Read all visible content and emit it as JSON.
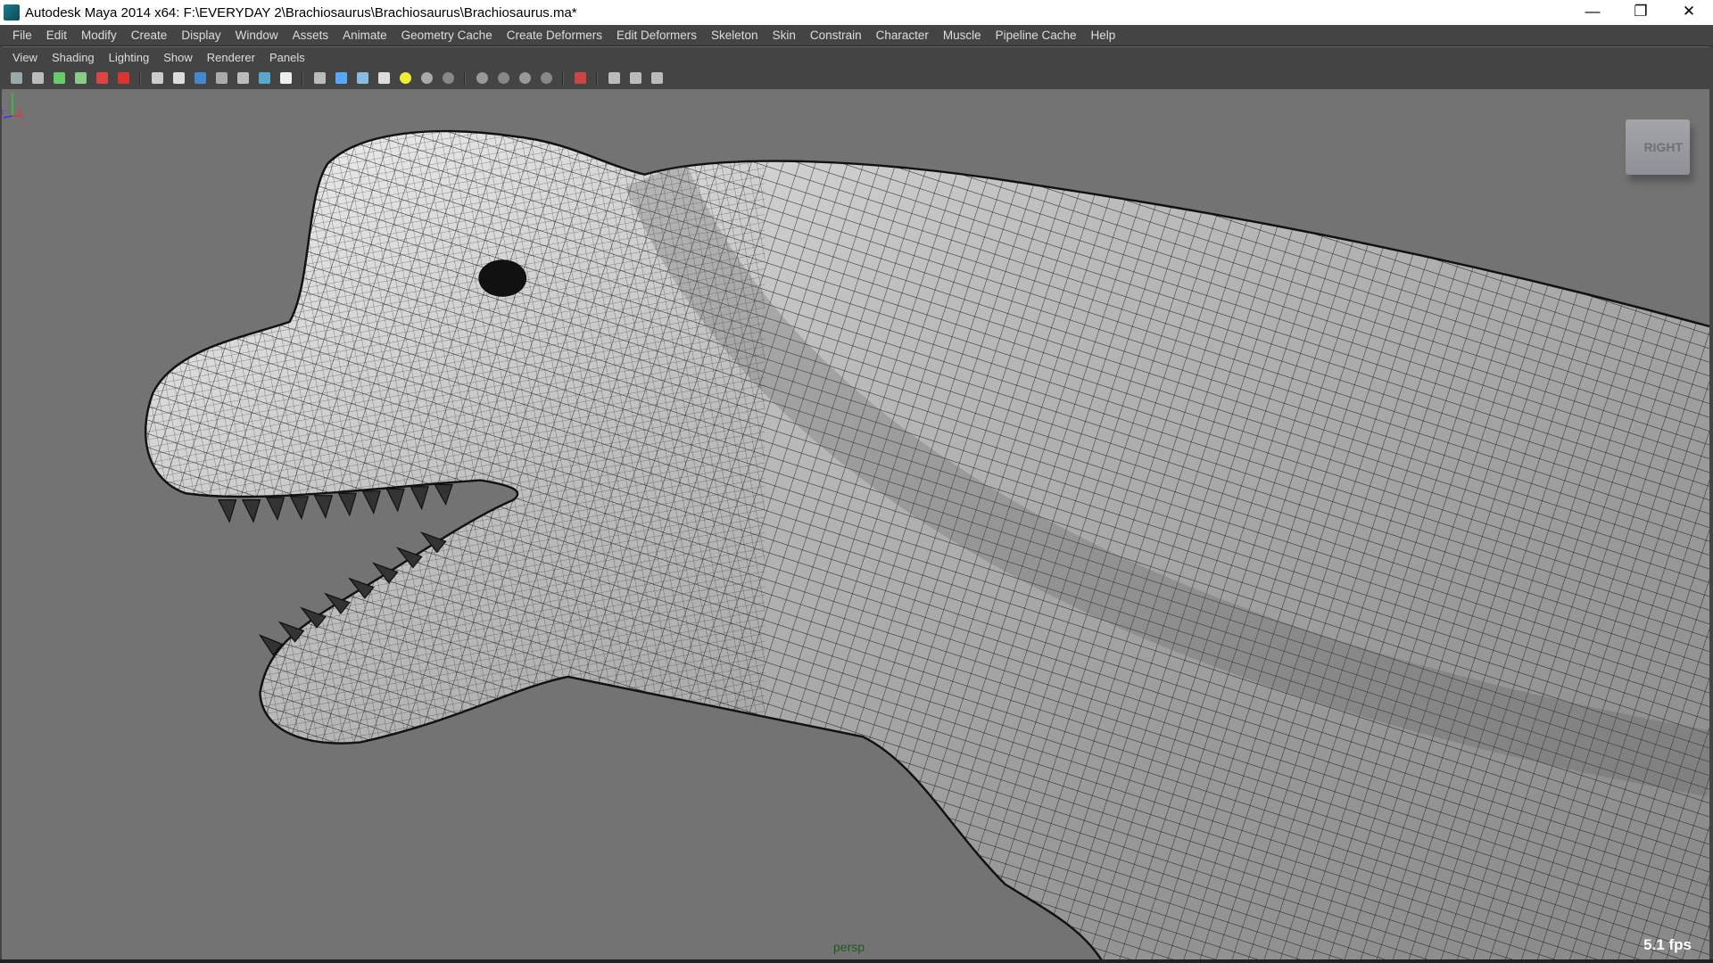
{
  "window": {
    "title": "Autodesk Maya 2014 x64: F:\\EVERYDAY 2\\Brachiosaurus\\Brachiosaurus\\Brachiosaurus.ma*",
    "minimize": "—",
    "restore": "❐",
    "close": "✕"
  },
  "menubar": [
    "File",
    "Edit",
    "Modify",
    "Create",
    "Display",
    "Window",
    "Assets",
    "Animate",
    "Geometry Cache",
    "Create Deformers",
    "Edit Deformers",
    "Skeleton",
    "Skin",
    "Constrain",
    "Character",
    "Muscle",
    "Pipeline Cache",
    "Help"
  ],
  "panel_menu": [
    "View",
    "Shading",
    "Lighting",
    "Show",
    "Renderer",
    "Panels"
  ],
  "toolbar_icons": [
    "select-camera-icon",
    "lock-camera-icon",
    "camera-attributes-icon",
    "bookmarks-icon",
    "image-plane-icon",
    "grease-pencil-icon",
    "|",
    "grid-icon",
    "film-gate-icon",
    "resolution-gate-icon",
    "gate-mask-icon",
    "field-chart-icon",
    "safe-action-icon",
    "safe-title-icon",
    "|",
    "wireframe-icon",
    "smooth-shade-icon",
    "wireframe-on-shaded-icon",
    "textured-icon",
    "use-all-lights-icon",
    "shadows-icon",
    "ambient-occlusion-icon",
    "|",
    "motion-blur-icon",
    "anti-aliasing-icon",
    "depth-of-field-icon",
    "screen-space-icon",
    "|",
    "isolate-select-icon",
    "|",
    "xray-icon",
    "xray-joints-icon",
    "xray-components-icon"
  ],
  "viewport": {
    "camera": "persp",
    "fps": "5.1 fps",
    "viewcube": "RIGHT",
    "axis": {
      "y": "y",
      "z": "z",
      "x": "x"
    }
  },
  "colors": {
    "viewport_bg": "#737373",
    "ui_bg": "#444444",
    "persp_label": "#1e5a1e"
  }
}
